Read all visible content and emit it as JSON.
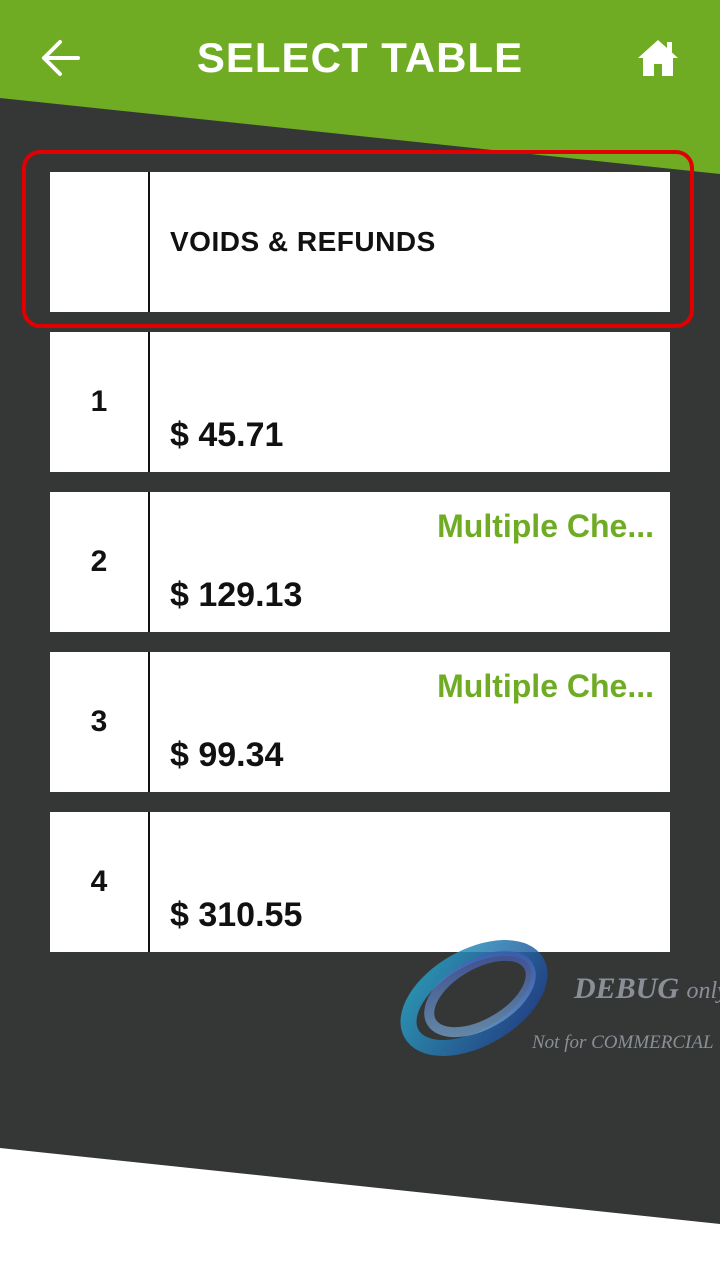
{
  "header": {
    "title": "SELECT TABLE",
    "back_icon": "arrow-left-icon",
    "home_icon": "home-icon"
  },
  "colors": {
    "accent": "#6fac24",
    "dark_bg": "#353737",
    "highlight": "#e00000"
  },
  "tables": [
    {
      "label": "VOIDS & REFUNDS"
    },
    {
      "number": "1",
      "amount": "$ 45.71",
      "status": ""
    },
    {
      "number": "2",
      "amount": "$ 129.13",
      "status": "Multiple Che..."
    },
    {
      "number": "3",
      "amount": "$ 99.34",
      "status": "Multiple Che..."
    },
    {
      "number": "4",
      "amount": "$ 310.55",
      "status": ""
    }
  ],
  "watermark": {
    "line1": "DEBUG",
    "line1_suffix": "only",
    "line2": "Not for COMMERCIAL"
  }
}
